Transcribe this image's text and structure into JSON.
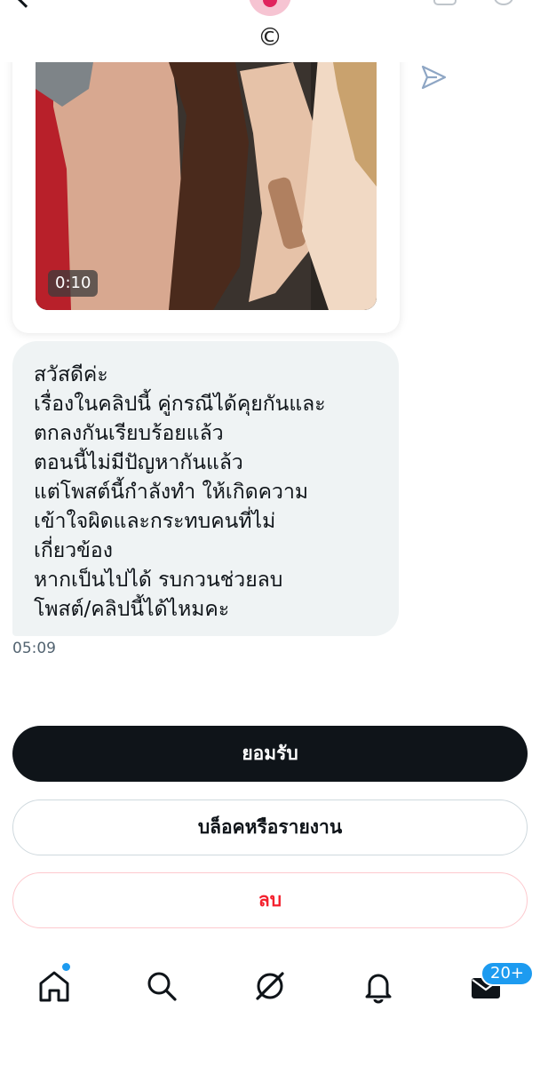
{
  "header": {
    "back_icon": "back-arrow-icon",
    "verified_symbol": "©"
  },
  "video": {
    "duration": "0:10",
    "send_icon": "send-icon"
  },
  "message": {
    "lines": [
      "สวัสดีค่ะ",
      "เรื่องในคลิปนี้ คู่กรณีได้คุยกันและ",
      "ตกลงกันเรียบร้อยแล้ว",
      "ตอนนี้ไม่มีปัญหากันแล้ว",
      "แต่โพสต์นี้กำลังทำ ให้เกิดความ",
      "เข้าใจผิดและกระทบคนที่ไม่",
      "เกี่ยวข้อง",
      "หากเป็นไปได้ รบกวนช่วยลบ",
      "โพสต์/คลิปนี้ได้ไหมคะ"
    ],
    "time": "05:09"
  },
  "actions": {
    "accept_label": "ยอมรับ",
    "block_label": "บล็อคหรือรายงาน",
    "delete_label": "ลบ"
  },
  "nav": {
    "items": [
      "home-icon",
      "search-icon",
      "grok-icon",
      "notifications-icon",
      "messages-icon"
    ],
    "messages_badge": "20+"
  },
  "colors": {
    "primary_dark": "#0f1419",
    "accent_blue": "#1d9bf0",
    "danger_red": "#f4212e",
    "bubble_bg": "#eff3f4"
  }
}
